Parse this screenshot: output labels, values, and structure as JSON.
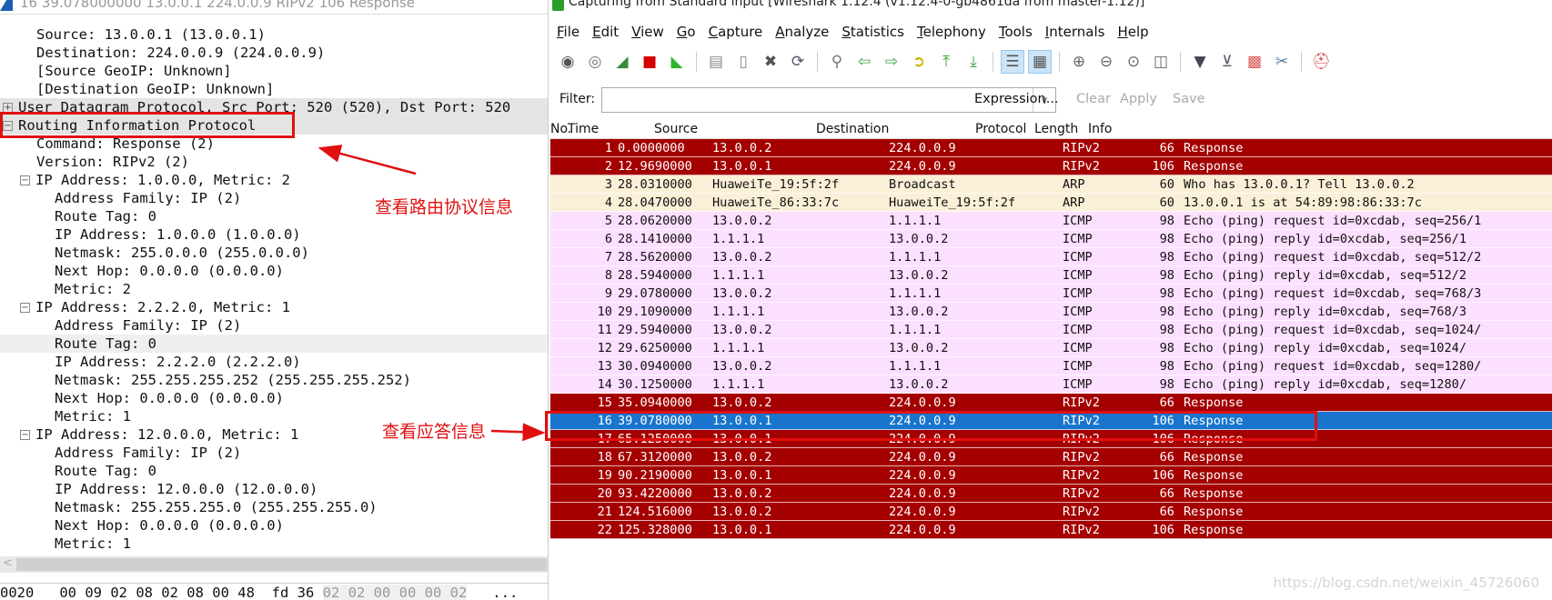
{
  "detail_pane": {
    "title": "16 39.078000000 13.0.0.1 224.0.0.9 RIPv2 106 Response",
    "lines": [
      {
        "text": "Source: 13.0.0.1 (13.0.0.1)",
        "level": 1
      },
      {
        "text": "Destination: 224.0.0.9 (224.0.0.9)",
        "level": 1
      },
      {
        "text": "[Source GeoIP: Unknown]",
        "level": 1
      },
      {
        "text": "[Destination GeoIP: Unknown]",
        "level": 1
      },
      {
        "text": "User Datagram Protocol, Src Port: 520 (520), Dst Port: 520",
        "level": 0,
        "expander": "+",
        "highlight": "hl"
      },
      {
        "text": "Routing Information Protocol",
        "level": 0,
        "expander": "-",
        "highlight": "hl"
      },
      {
        "text": "Command: Response (2)",
        "level": 1
      },
      {
        "text": "Version: RIPv2 (2)",
        "level": 1
      },
      {
        "text": "IP Address: 1.0.0.0, Metric: 2",
        "level": 1,
        "expander": "-"
      },
      {
        "text": "Address Family: IP (2)",
        "level": 2
      },
      {
        "text": "Route Tag: 0",
        "level": 2
      },
      {
        "text": "IP Address: 1.0.0.0 (1.0.0.0)",
        "level": 2
      },
      {
        "text": "Netmask: 255.0.0.0 (255.0.0.0)",
        "level": 2
      },
      {
        "text": "Next Hop: 0.0.0.0 (0.0.0.0)",
        "level": 2
      },
      {
        "text": "Metric: 2",
        "level": 2
      },
      {
        "text": "IP Address: 2.2.2.0, Metric: 1",
        "level": 1,
        "expander": "-"
      },
      {
        "text": "Address Family: IP (2)",
        "level": 2
      },
      {
        "text": "Route Tag: 0",
        "level": 2,
        "highlight": "hl2"
      },
      {
        "text": "IP Address: 2.2.2.0 (2.2.2.0)",
        "level": 2
      },
      {
        "text": "Netmask: 255.255.255.252 (255.255.255.252)",
        "level": 2
      },
      {
        "text": "Next Hop: 0.0.0.0 (0.0.0.0)",
        "level": 2
      },
      {
        "text": "Metric: 1",
        "level": 2
      },
      {
        "text": "IP Address: 12.0.0.0, Metric: 1",
        "level": 1,
        "expander": "-"
      },
      {
        "text": "Address Family: IP (2)",
        "level": 2
      },
      {
        "text": "Route Tag: 0",
        "level": 2
      },
      {
        "text": "IP Address: 12.0.0.0 (12.0.0.0)",
        "level": 2
      },
      {
        "text": "Netmask: 255.255.255.0 (255.255.255.0)",
        "level": 2
      },
      {
        "text": "Next Hop: 0.0.0.0 (0.0.0.0)",
        "level": 2
      },
      {
        "text": "Metric: 1",
        "level": 2
      }
    ],
    "hex": {
      "offset": "0020",
      "bytes": "00 09 02 08 02 08 00 48  fd 36",
      "dim_bytes": "02 02 00 00 00 02",
      "more": "..."
    }
  },
  "window": {
    "title": "Capturing from Standard input    [Wireshark 1.12.4  (v1.12.4-0-gb4861da from master-1.12)]"
  },
  "menu": [
    "File",
    "Edit",
    "View",
    "Go",
    "Capture",
    "Analyze",
    "Statistics",
    "Telephony",
    "Tools",
    "Internals",
    "Help"
  ],
  "toolbar": [
    {
      "icon": "interfaces-icon",
      "glyph": "◉",
      "color": "#555"
    },
    {
      "icon": "options-icon",
      "glyph": "◎",
      "color": "#777"
    },
    {
      "icon": "start-capture-icon",
      "glyph": "◢",
      "color": "#3a8a3a"
    },
    {
      "icon": "stop-capture-icon",
      "glyph": "■",
      "color": "#d40000"
    },
    {
      "icon": "restart-capture-icon",
      "glyph": "◣",
      "color": "#2db52d"
    },
    {
      "sep": true
    },
    {
      "icon": "open-file-icon",
      "glyph": "▤",
      "color": "#888"
    },
    {
      "icon": "save-file-icon",
      "glyph": "▯",
      "color": "#888"
    },
    {
      "icon": "close-file-icon",
      "glyph": "✖",
      "color": "#555"
    },
    {
      "icon": "reload-icon",
      "glyph": "⟳",
      "color": "#556"
    },
    {
      "sep": true
    },
    {
      "icon": "find-packet-icon",
      "glyph": "⚲",
      "color": "#777"
    },
    {
      "icon": "go-back-icon",
      "glyph": "⇦",
      "color": "#3aa33a"
    },
    {
      "icon": "go-forward-icon",
      "glyph": "⇨",
      "color": "#3aa33a"
    },
    {
      "icon": "go-to-packet-icon",
      "glyph": "➲",
      "color": "#c8b400"
    },
    {
      "icon": "first-packet-icon",
      "glyph": "⤒",
      "color": "#3aa33a"
    },
    {
      "icon": "last-packet-icon",
      "glyph": "⤓",
      "color": "#3aa33a"
    },
    {
      "sep": true
    },
    {
      "icon": "colorize-icon",
      "glyph": "☰",
      "color": "#555",
      "active": true
    },
    {
      "icon": "auto-scroll-icon",
      "glyph": "▦",
      "color": "#555",
      "active": true
    },
    {
      "sep": true
    },
    {
      "icon": "zoom-in-icon",
      "glyph": "⊕",
      "color": "#666"
    },
    {
      "icon": "zoom-out-icon",
      "glyph": "⊖",
      "color": "#666"
    },
    {
      "icon": "normal-size-icon",
      "glyph": "⊙",
      "color": "#666"
    },
    {
      "icon": "resize-columns-icon",
      "glyph": "◫",
      "color": "#666"
    },
    {
      "sep": true
    },
    {
      "icon": "capture-filters-icon",
      "glyph": "▼",
      "color": "#445"
    },
    {
      "icon": "display-filters-icon",
      "glyph": "⊻",
      "color": "#556"
    },
    {
      "icon": "coloring-rules-icon",
      "glyph": "▩",
      "color": "#d9534f"
    },
    {
      "icon": "preferences-icon",
      "glyph": "✂",
      "color": "#5a7fa0"
    },
    {
      "sep": true
    },
    {
      "icon": "help-icon",
      "glyph": "⛑",
      "color": "#d9534f"
    }
  ],
  "filter": {
    "label": "Filter:",
    "value": "",
    "expression": "Expression...",
    "clear": "Clear",
    "apply": "Apply",
    "save": "Save"
  },
  "packet_list": {
    "columns": [
      "No.",
      "Time",
      "Source",
      "Destination",
      "Protocol",
      "Length",
      "Info"
    ],
    "rows": [
      [
        "1",
        "0.0000000",
        "13.0.0.2",
        "224.0.0.9",
        "RIPv2",
        "66",
        "Response",
        "rip"
      ],
      [
        "2",
        "12.9690000",
        "13.0.0.1",
        "224.0.0.9",
        "RIPv2",
        "106",
        "Response",
        "rip"
      ],
      [
        "3",
        "28.0310000",
        "HuaweiTe_19:5f:2f",
        "Broadcast",
        "ARP",
        "60",
        "Who has 13.0.0.1?  Tell 13.0.0.2",
        "arp"
      ],
      [
        "4",
        "28.0470000",
        "HuaweiTe_86:33:7c",
        "HuaweiTe_19:5f:2f",
        "ARP",
        "60",
        "13.0.0.1 is at 54:89:98:86:33:7c",
        "arp"
      ],
      [
        "5",
        "28.0620000",
        "13.0.0.2",
        "1.1.1.1",
        "ICMP",
        "98",
        "Echo (ping) request  id=0xcdab, seq=256/1",
        "icmp"
      ],
      [
        "6",
        "28.1410000",
        "1.1.1.1",
        "13.0.0.2",
        "ICMP",
        "98",
        "Echo (ping) reply    id=0xcdab, seq=256/1",
        "icmp"
      ],
      [
        "7",
        "28.5620000",
        "13.0.0.2",
        "1.1.1.1",
        "ICMP",
        "98",
        "Echo (ping) request  id=0xcdab, seq=512/2",
        "icmp"
      ],
      [
        "8",
        "28.5940000",
        "1.1.1.1",
        "13.0.0.2",
        "ICMP",
        "98",
        "Echo (ping) reply    id=0xcdab, seq=512/2",
        "icmp"
      ],
      [
        "9",
        "29.0780000",
        "13.0.0.2",
        "1.1.1.1",
        "ICMP",
        "98",
        "Echo (ping) request  id=0xcdab, seq=768/3",
        "icmp"
      ],
      [
        "10",
        "29.1090000",
        "1.1.1.1",
        "13.0.0.2",
        "ICMP",
        "98",
        "Echo (ping) reply    id=0xcdab, seq=768/3",
        "icmp"
      ],
      [
        "11",
        "29.5940000",
        "13.0.0.2",
        "1.1.1.1",
        "ICMP",
        "98",
        "Echo (ping) request  id=0xcdab, seq=1024/",
        "icmp"
      ],
      [
        "12",
        "29.6250000",
        "1.1.1.1",
        "13.0.0.2",
        "ICMP",
        "98",
        "Echo (ping) reply    id=0xcdab, seq=1024/",
        "icmp"
      ],
      [
        "13",
        "30.0940000",
        "13.0.0.2",
        "1.1.1.1",
        "ICMP",
        "98",
        "Echo (ping) request  id=0xcdab, seq=1280/",
        "icmp"
      ],
      [
        "14",
        "30.1250000",
        "1.1.1.1",
        "13.0.0.2",
        "ICMP",
        "98",
        "Echo (ping) reply    id=0xcdab, seq=1280/",
        "icmp"
      ],
      [
        "15",
        "35.0940000",
        "13.0.0.2",
        "224.0.0.9",
        "RIPv2",
        "66",
        "Response",
        "rip"
      ],
      [
        "16",
        "39.0780000",
        "13.0.0.1",
        "224.0.0.9",
        "RIPv2",
        "106",
        "Response",
        "sel"
      ],
      [
        "17",
        "65.1250000",
        "13.0.0.1",
        "224.0.0.9",
        "RIPv2",
        "106",
        "Response",
        "rip"
      ],
      [
        "18",
        "67.3120000",
        "13.0.0.2",
        "224.0.0.9",
        "RIPv2",
        "66",
        "Response",
        "rip"
      ],
      [
        "19",
        "90.2190000",
        "13.0.0.1",
        "224.0.0.9",
        "RIPv2",
        "106",
        "Response",
        "rip"
      ],
      [
        "20",
        "93.4220000",
        "13.0.0.2",
        "224.0.0.9",
        "RIPv2",
        "66",
        "Response",
        "rip"
      ],
      [
        "21",
        "124.516000",
        "13.0.0.2",
        "224.0.0.9",
        "RIPv2",
        "66",
        "Response",
        "rip"
      ],
      [
        "22",
        "125.328000",
        "13.0.0.1",
        "224.0.0.9",
        "RIPv2",
        "106",
        "Response",
        "rip"
      ]
    ],
    "selected_no": "16"
  },
  "annotations": {
    "routing_info": "查看路由协议信息",
    "response_info": "查看应答信息",
    "color": "#e01010"
  },
  "watermark": "https://blog.csdn.net/weixin_45726060",
  "colors": {
    "rip_row": "#a40000",
    "arp_row": "#faf0d7",
    "icmp_row": "#fce0ff",
    "selected_row": "#1874cd"
  }
}
